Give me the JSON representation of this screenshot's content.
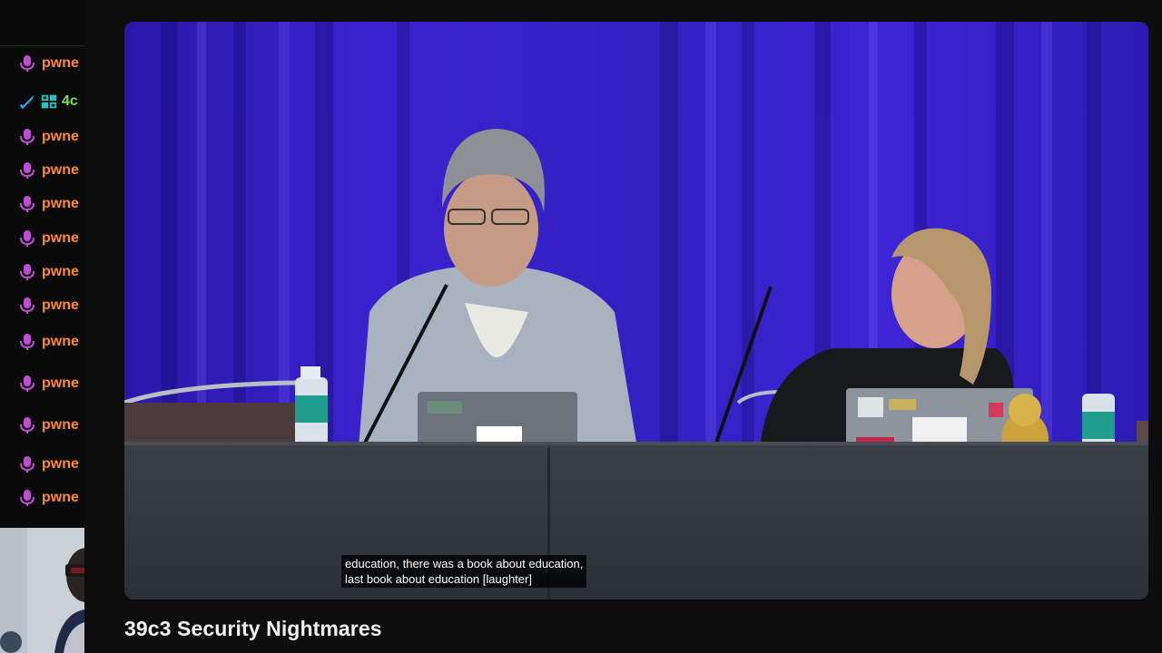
{
  "chat": {
    "messages": [
      {
        "icon": "mic-icon",
        "user": "pwne"
      },
      {
        "icon": "sword-icon",
        "user": "4c",
        "special": true
      },
      {
        "icon": "mic-icon",
        "user": "pwne"
      },
      {
        "icon": "mic-icon",
        "user": "pwne"
      },
      {
        "icon": "mic-icon",
        "user": "pwne"
      },
      {
        "icon": "mic-icon",
        "user": "pwne"
      },
      {
        "icon": "mic-icon",
        "user": "pwne"
      },
      {
        "icon": "mic-icon",
        "user": "pwne"
      },
      {
        "icon": "mic-icon",
        "user": "pwne"
      },
      {
        "icon": "mic-icon",
        "user": "pwne"
      },
      {
        "icon": "mic-icon",
        "user": "pwne"
      },
      {
        "icon": "mic-icon",
        "user": "pwne"
      },
      {
        "icon": "mic-icon",
        "user": "pwne"
      }
    ],
    "user_color": "#ff8a2a",
    "special_user_color": "#7fe050",
    "icon_color": "#c44bd8"
  },
  "video": {
    "captions": {
      "line1": "education, there was a book about education,",
      "line2": "last book about education [laughter]"
    }
  },
  "stream": {
    "title": "39c3 Security Nightmares"
  }
}
